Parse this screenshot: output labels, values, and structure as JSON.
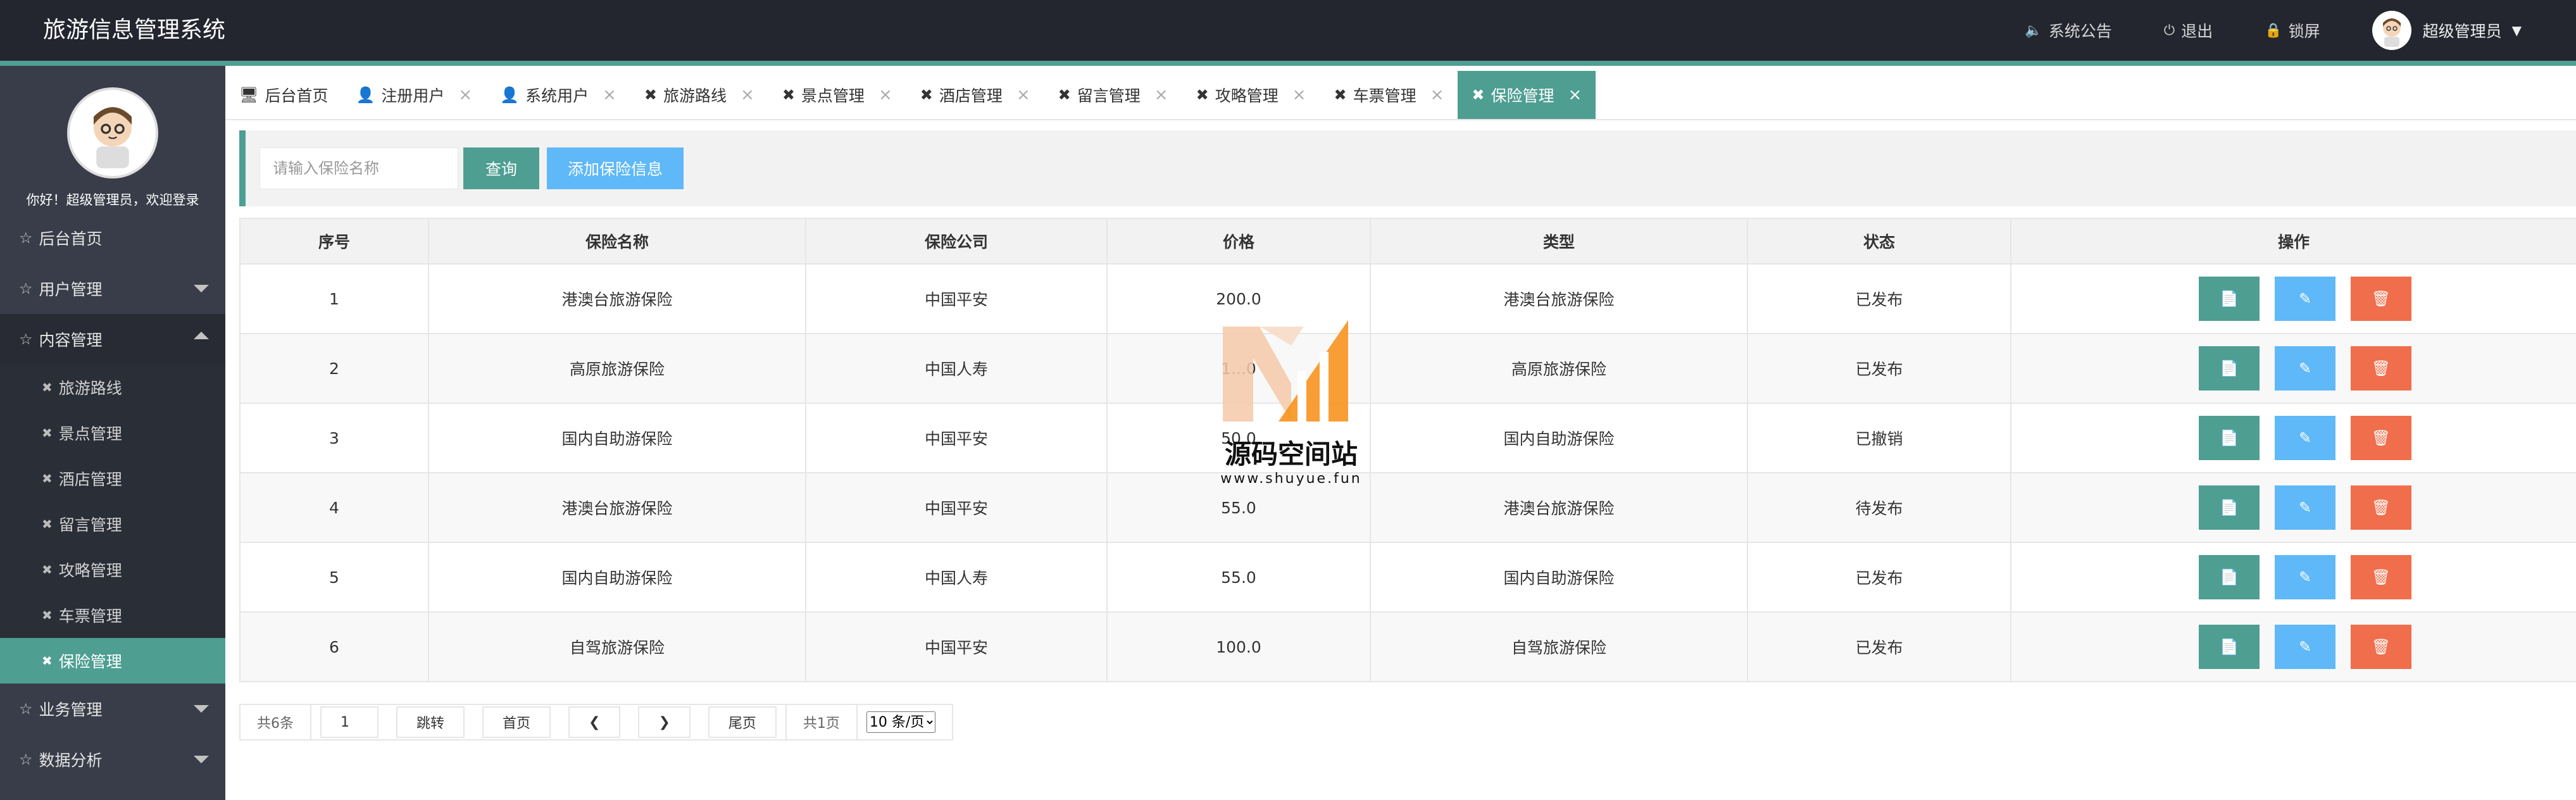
{
  "app": {
    "title": "旅游信息管理系统"
  },
  "topnav": {
    "announce": "系统公告",
    "logout": "退出",
    "lock": "锁屏",
    "user": "超级管理员"
  },
  "sidebar": {
    "welcome": "你好！超级管理员，欢迎登录",
    "home": "后台首页",
    "user_mgmt": "用户管理",
    "content_mgmt": "内容管理",
    "sub_items": [
      "旅游路线",
      "景点管理",
      "酒店管理",
      "留言管理",
      "攻略管理",
      "车票管理",
      "保险管理"
    ],
    "business_mgmt": "业务管理",
    "data_analysis": "数据分析"
  },
  "tabs": [
    "后台首页",
    "注册用户",
    "系统用户",
    "旅游路线",
    "景点管理",
    "酒店管理",
    "留言管理",
    "攻略管理",
    "车票管理",
    "保险管理"
  ],
  "toolbar": {
    "search_placeholder": "请输入保险名称",
    "query": "查询",
    "add": "添加保险信息"
  },
  "table": {
    "headers": [
      "序号",
      "保险名称",
      "保险公司",
      "价格",
      "类型",
      "状态",
      "操作"
    ],
    "rows": [
      [
        "1",
        "港澳台旅游保险",
        "中国平安",
        "200.0",
        "港澳台旅游保险",
        "已发布"
      ],
      [
        "2",
        "高原旅游保险",
        "中国人寿",
        "1...0",
        "高原旅游保险",
        "已发布"
      ],
      [
        "3",
        "国内自助游保险",
        "中国平安",
        "50.0",
        "国内自助游保险",
        "已撤销"
      ],
      [
        "4",
        "港澳台旅游保险",
        "中国平安",
        "55.0",
        "港澳台旅游保险",
        "待发布"
      ],
      [
        "5",
        "国内自助游保险",
        "中国人寿",
        "55.0",
        "国内自助游保险",
        "已发布"
      ],
      [
        "6",
        "自驾旅游保险",
        "中国平安",
        "100.0",
        "自驾旅游保险",
        "已发布"
      ]
    ]
  },
  "pager": {
    "total": "共6条",
    "page_input": "1",
    "jump": "跳转",
    "first": "首页",
    "prev": "❮",
    "next": "❯",
    "last": "尾页",
    "pages": "共1页",
    "per_page": "10 条/页"
  },
  "watermark": {
    "text": "源码空间站",
    "url": "www.shuyue.fun"
  },
  "colors": {
    "accent": "#4e9e92",
    "header": "#23262e",
    "sidebar": "#393d49",
    "blue": "#5fb8f7",
    "danger": "#f06e4c"
  }
}
